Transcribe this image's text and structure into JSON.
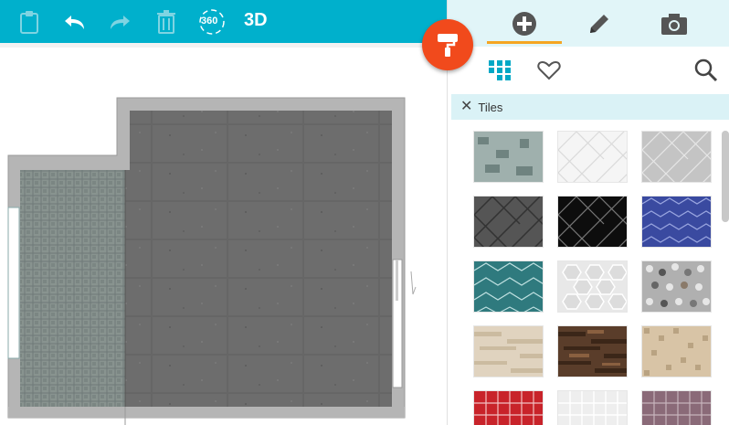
{
  "toolbar": {
    "items": [
      "clipboard-icon",
      "undo-icon",
      "redo-icon",
      "trash-icon",
      "view-360-icon"
    ],
    "view_360_label": "360",
    "view_3d_label": "3D"
  },
  "panel": {
    "tabs": [
      "add-icon",
      "pencil-icon",
      "camera-icon"
    ],
    "active_tab": 0,
    "sub_icons": [
      "catalog-grid-icon",
      "favorites-heart-icon",
      "search-icon"
    ],
    "breadcrumb_label": "Tiles"
  },
  "tiles": [
    {
      "name": "tile-marble-green-mosaic",
      "bg": "#8fa3a0"
    },
    {
      "name": "tile-white-herringbone",
      "bg": "#f5f5f5"
    },
    {
      "name": "tile-grey-herringbone",
      "bg": "#c2c2c2"
    },
    {
      "name": "tile-dark-grey-herringbone",
      "bg": "#555"
    },
    {
      "name": "tile-black-herringbone",
      "bg": "#0d0d0d"
    },
    {
      "name": "tile-blue-chevron",
      "bg": "#3a4aa0"
    },
    {
      "name": "tile-teal-chevron",
      "bg": "#2f7a7e"
    },
    {
      "name": "tile-white-hexagon",
      "bg": "#e8e8e8"
    },
    {
      "name": "tile-grey-penny-mosaic",
      "bg": "#9a9a9a"
    },
    {
      "name": "tile-beige-stone-stack",
      "bg": "#e0d3bf"
    },
    {
      "name": "tile-brown-stone-stack",
      "bg": "#5a3d2a"
    },
    {
      "name": "tile-beige-small-mosaic",
      "bg": "#d8c4a6"
    },
    {
      "name": "tile-red-square",
      "bg": "#c8232a"
    },
    {
      "name": "tile-white-square",
      "bg": "#eeeeee"
    },
    {
      "name": "tile-mauve-square",
      "bg": "#8a6a78"
    }
  ]
}
